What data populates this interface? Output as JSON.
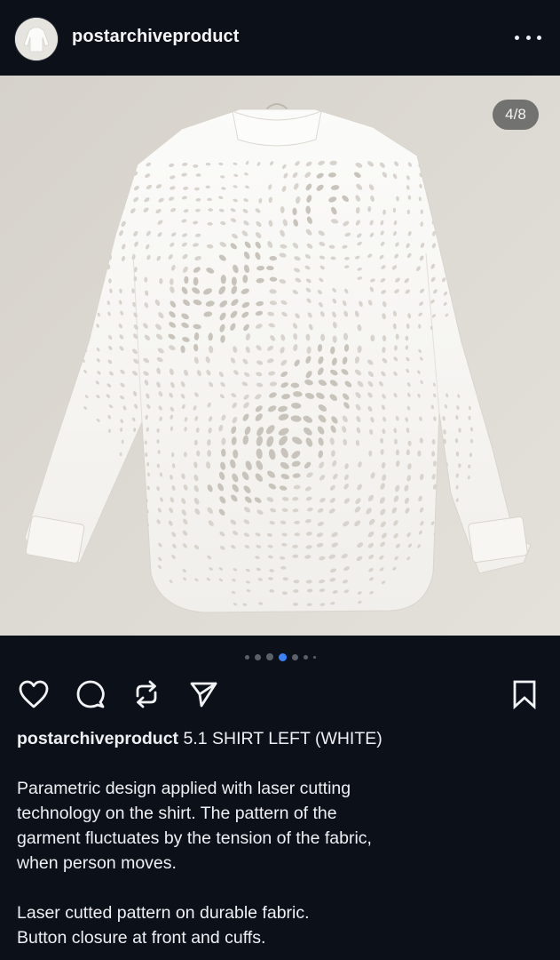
{
  "post": {
    "username": "postarchiveproduct",
    "image_counter": "4/8",
    "carousel": {
      "total_dots": 7,
      "active_index": 3
    },
    "caption_title": "5.1 SHIRT LEFT (WHITE)",
    "caption_lines": [
      "Parametric design applied with laser cutting",
      "technology on the shirt. The pattern of the",
      "garment fluctuates by the tension of the fabric,",
      "when person moves.",
      "",
      "Laser cutted pattern on durable fabric.",
      "Button closure at front and cuffs."
    ]
  },
  "icons": {
    "more": "more-horizontal-icon",
    "like": "heart-icon",
    "comment": "comment-bubble-icon",
    "repost": "repost-arrows-icon",
    "share": "send-plane-icon",
    "save": "bookmark-icon"
  },
  "colors": {
    "background": "#0c1019",
    "text": "#eef0f3",
    "active_dot": "#3b82f6",
    "photo_background": "#dcd8d1"
  }
}
